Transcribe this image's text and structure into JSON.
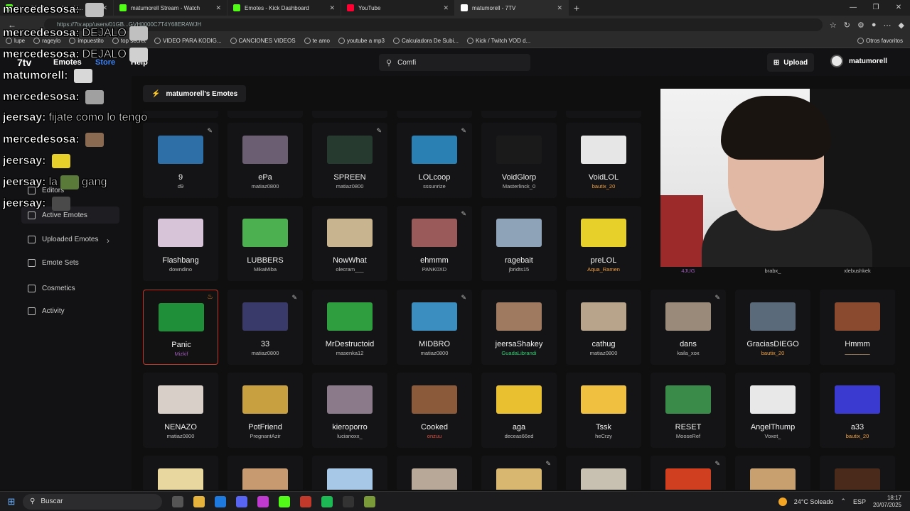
{
  "browser": {
    "tabs": [
      {
        "label": "k... ...21 Stream - W... Li...",
        "color": "#53fc18"
      },
      {
        "label": "matumorell Stream - Watch",
        "color": "#53fc18"
      },
      {
        "label": "Emotes - Kick Dashboard",
        "color": "#53fc18"
      },
      {
        "label": "YouTube",
        "color": "#ff0033"
      },
      {
        "label": "matumorell - 7TV",
        "color": "#ffffff",
        "active": true
      }
    ],
    "url": "https://7tv.app/users/01GB...GVH0000C7T4Y68ERAWJH",
    "bookmarks": [
      "lupe",
      "rageylo",
      "impuestito",
      "top secret",
      "VIDEO PARA KODIG...",
      "CANCIONES VIDEOS",
      "te amo",
      "youtube a mp3",
      "Calculadora De Subi...",
      "Kick / Twitch VOD d..."
    ],
    "bookmarks_right": "Otros favoritos"
  },
  "app": {
    "logo": "7tv",
    "nav": {
      "emotes": "Emotes",
      "store": "Store",
      "help": "Help"
    },
    "search_value": "Comfi",
    "upload_label": "Upload",
    "username": "matumorell",
    "set_title": "matumorell's Emotes"
  },
  "sidebar": {
    "items": [
      {
        "label": "Editors"
      },
      {
        "label": "Active Emotes",
        "active": true
      },
      {
        "label": "Uploaded Emotes"
      },
      {
        "label": "Emote Sets"
      },
      {
        "label": "Cosmetics"
      },
      {
        "label": "Activity"
      }
    ]
  },
  "emotes": {
    "row1": [
      {
        "name": "9",
        "owner": "d9",
        "color": "#2e6fa8",
        "pencil": true
      },
      {
        "name": "ePa",
        "owner": "matiaz0800",
        "color": "#6b5e73",
        "pencil": false
      },
      {
        "name": "SPREEN",
        "owner": "matiaz0800",
        "color": "#263a2f",
        "pencil": true
      },
      {
        "name": "LOLcoop",
        "owner": "sssunrize",
        "color": "#2a7fb3",
        "pencil": true
      },
      {
        "name": "VoidGlorp",
        "owner": "Masterlinck_0",
        "color": "#1a1a1a",
        "pencil": false
      },
      {
        "name": "VoidLOL",
        "owner": "bautix_20",
        "owner_color": "#f0a040",
        "color": "#e6e6e6",
        "pencil": false
      }
    ],
    "row1_tail": [
      "4JUG",
      "brabx_",
      "xlebushkek"
    ],
    "row2": [
      {
        "name": "Flashbang",
        "owner": "downdino",
        "color": "#d8c4d8",
        "pencil": false
      },
      {
        "name": "LUBBERS",
        "owner": "MikaMiba",
        "color": "#4caf50",
        "pencil": false
      },
      {
        "name": "NowWhat",
        "owner": "olecram___",
        "color": "#c8b48e",
        "pencil": false
      },
      {
        "name": "ehmmm",
        "owner": "PANK0XD",
        "color": "#9a5a5a",
        "pencil": true
      },
      {
        "name": "ragebait",
        "owner": "jbridts15",
        "color": "#8fa3b8",
        "pencil": false
      },
      {
        "name": "preLOL",
        "owner": "Aqua_Ramen",
        "owner_color": "#f0a040",
        "color": "#e8d02a",
        "pencil": false
      }
    ],
    "row3": [
      {
        "name": "Panic",
        "owner": "Mizkif",
        "owner_color": "#9b59b6",
        "color": "#1f8f3a",
        "selected": true,
        "flame": true
      },
      {
        "name": "33",
        "owner": "matiaz0800",
        "color": "#3a3a6a",
        "pencil": true
      },
      {
        "name": "MrDestructoid",
        "owner": "masenka12",
        "color": "#2e9e3e",
        "pencil": false
      },
      {
        "name": "MIDBRO",
        "owner": "matiaz0800",
        "color": "#3a8ec0",
        "pencil": true
      },
      {
        "name": "jeersaShakey",
        "owner": "GuadaLibrandi",
        "owner_color": "#2ecc71",
        "color": "#a07a60",
        "pencil": false
      },
      {
        "name": "cathug",
        "owner": "matiaz0800",
        "color": "#b8a48a",
        "pencil": false
      },
      {
        "name": "dans",
        "owner": "kaila_xox",
        "color": "#9a8a7a",
        "pencil": true
      },
      {
        "name": "GraciasDIEGO",
        "owner": "bautix_20",
        "owner_color": "#f0a040",
        "color": "#5a6a7a",
        "pencil": false
      },
      {
        "name": "Hmmm",
        "owner": "ــــــــــــــــ",
        "owner_color": "#c49a6c",
        "color": "#8a4a30",
        "pencil": false
      }
    ],
    "row4": [
      {
        "name": "NENAZO",
        "owner": "matiaz0800",
        "color": "#d8d0c8",
        "pencil": false
      },
      {
        "name": "PotFriend",
        "owner": "PregnantAzir",
        "color": "#c8a040",
        "pencil": false
      },
      {
        "name": "kieroporro",
        "owner": "lucianoxx_",
        "color": "#8a7a8a",
        "pencil": false
      },
      {
        "name": "Cooked",
        "owner": "onzuu",
        "owner_color": "#e74c3c",
        "color": "#8a5a3a",
        "pencil": false
      },
      {
        "name": "aga",
        "owner": "deceas66ed",
        "color": "#e8c030",
        "pencil": false
      },
      {
        "name": "Tssk",
        "owner": "heCrzy",
        "color": "#f0c040",
        "pencil": false
      },
      {
        "name": "RESET",
        "owner": "MooseRef",
        "color": "#3a8a4a",
        "pencil": false
      },
      {
        "name": "AngelThump",
        "owner": "Voxet_",
        "color": "#e8e8e8",
        "pencil": false
      },
      {
        "name": "a33",
        "owner": "bautix_20",
        "owner_color": "#f0a040",
        "color": "#3a3ad0",
        "pencil": false
      }
    ],
    "row5": [
      {
        "color": "#e8d8a0",
        "pencil": false
      },
      {
        "color": "#c89a70",
        "pencil": false
      },
      {
        "color": "#a8c8e8",
        "pencil": false
      },
      {
        "color": "#b8a898",
        "pencil": false
      },
      {
        "color": "#d8b870",
        "pencil": true
      },
      {
        "color": "#c8c0b0",
        "pencil": false
      },
      {
        "color": "#d04020",
        "pencil": true
      },
      {
        "color": "#c8a070",
        "pencil": false
      },
      {
        "color": "#4a2a1a",
        "pencil": false
      }
    ]
  },
  "chat": [
    {
      "user": "mercedesosa:",
      "msg": "",
      "tail": ""
    },
    {
      "user": "mercedesosa:",
      "msg": "DEJALO",
      "tail": ""
    },
    {
      "user": "mercedesosa:",
      "msg": "DEJALO",
      "tail": ""
    },
    {
      "user": "matumorell:",
      "msg": "",
      "tail": ""
    },
    {
      "user": "mercedesosa:",
      "msg": "",
      "tail": ""
    },
    {
      "user": "jeersay:",
      "msg": "fijate como lo tengo",
      "tail": ""
    },
    {
      "user": "mercedesosa:",
      "msg": "",
      "tail": ""
    },
    {
      "user": "jeersay:",
      "msg": "",
      "tail": ""
    },
    {
      "user": "jeersay:",
      "msg": "la",
      "tail": "gang"
    },
    {
      "user": "jeersay:",
      "msg": "",
      "tail": ""
    }
  ],
  "taskbar": {
    "search": "Buscar",
    "weather": "24°C  Soleado",
    "lang": "ESP",
    "time": "18:17",
    "date": "20/07/2025"
  }
}
